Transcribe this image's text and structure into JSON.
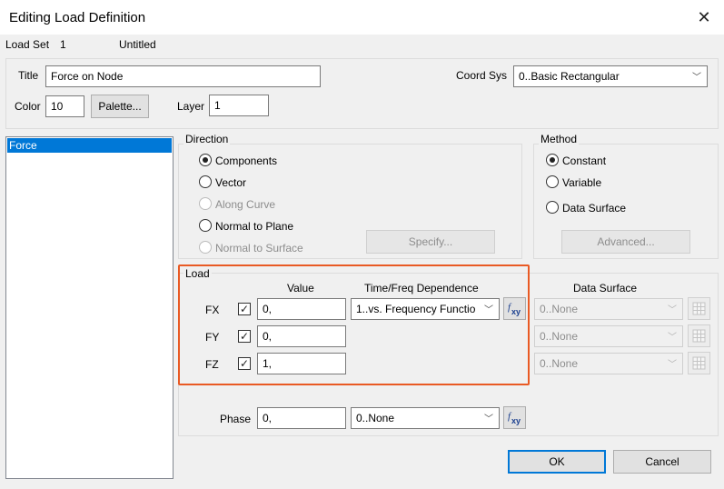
{
  "window": {
    "title": "Editing Load Definition",
    "close_label": "✕"
  },
  "loadset": {
    "label": "Load Set",
    "id": "1",
    "name": "Untitled"
  },
  "header": {
    "title_label": "Title",
    "title_value": "Force on Node",
    "coord_label": "Coord Sys",
    "coord_value": "0..Basic Rectangular",
    "color_label": "Color",
    "color_value": "10",
    "palette_label": "Palette...",
    "layer_label": "Layer",
    "layer_value": "1"
  },
  "load_list": {
    "items": [
      "Force"
    ]
  },
  "direction": {
    "label": "Direction",
    "options": [
      "Components",
      "Vector",
      "Along Curve",
      "Normal to Plane",
      "Normal to Surface"
    ],
    "selected": "Components",
    "specify_label": "Specify..."
  },
  "method": {
    "label": "Method",
    "options": [
      "Constant",
      "Variable",
      "Data Surface"
    ],
    "selected": "Constant",
    "advanced_label": "Advanced..."
  },
  "load": {
    "label": "Load",
    "col_value": "Value",
    "col_time": "Time/Freq Dependence",
    "col_surface": "Data Surface",
    "rows": [
      {
        "name": "FX",
        "value": "0,",
        "time": "1..vs. Frequency Functio",
        "surface": "0..None"
      },
      {
        "name": "FY",
        "value": "0,",
        "surface": "0..None"
      },
      {
        "name": "FZ",
        "value": "1,",
        "surface": "0..None"
      }
    ],
    "phase_label": "Phase",
    "phase_value": "0,",
    "phase_time": "0..None"
  },
  "footer": {
    "ok_label": "OK",
    "cancel_label": "Cancel"
  },
  "colors": {
    "accent": "#0078d7",
    "highlight": "#e95a24"
  }
}
